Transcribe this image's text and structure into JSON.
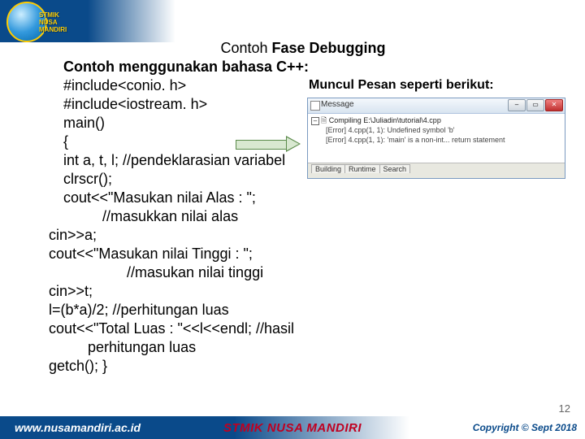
{
  "logo": {
    "line1": "STMIK",
    "line2": "NUSA MANDIRI"
  },
  "title": {
    "prefix": "Contoh ",
    "bold": "Fase Debugging"
  },
  "subtitle": "Contoh menggunakan bahasa C++:",
  "message_label": "Muncul Pesan seperti berikut:",
  "code": {
    "l1": "#include<conio. h>",
    "l2": "#include<iostream. h>",
    "l3": "main()",
    "l4": "{",
    "l5": "int a, t, l; //pendeklarasian variabel",
    "l6": "clrscr();",
    "l7": "cout<<\"Masukan nilai Alas : \";",
    "l8": "//masukkan nilai alas",
    "l9": "cin>>a;",
    "l10": "cout<<\"Masukan nilai Tinggi : \";",
    "l11": "//masukan nilai tinggi",
    "l12": "cin>>t;",
    "l13": "l=(b*a)/2; //perhitungan luas",
    "l14": "cout<<\"Total Luas : \"<<l<<endl; //hasil",
    "l15": "perhitungan luas",
    "l16": "getch(); }"
  },
  "msgwin": {
    "title": "Message",
    "line1": "Compiling E:\\Juliadin\\tutorial\\4.cpp",
    "line2": "[Error] 4.cpp(1, 1): Undefined symbol 'b'",
    "line3": "[Error] 4.cpp(1, 1): 'main' is a non-int... return statement",
    "tab1": "Building",
    "tab2": "Runtime",
    "tab3": "Search",
    "min": "–",
    "max": "▭",
    "close": "✕"
  },
  "footer": {
    "url": "www.nusamandiri.ac.id",
    "center": "STMIK NUSA MANDIRI",
    "right": "Copyright © Sept  2018"
  },
  "pagenum": "12"
}
